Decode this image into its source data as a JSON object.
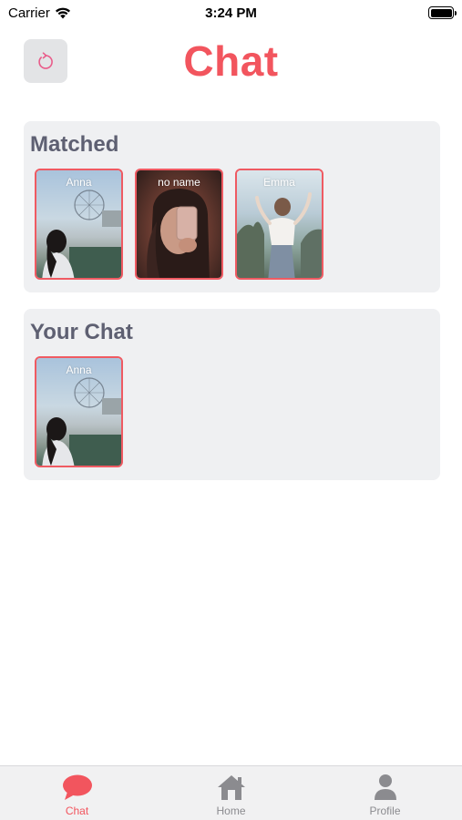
{
  "status_bar": {
    "carrier": "Carrier",
    "time": "3:24 PM"
  },
  "header": {
    "title": "Chat"
  },
  "matched": {
    "title": "Matched",
    "cards": [
      {
        "name": "Anna"
      },
      {
        "name": "no name"
      },
      {
        "name": "Emma"
      }
    ]
  },
  "your_chat": {
    "title": "Your Chat",
    "cards": [
      {
        "name": "Anna"
      }
    ]
  },
  "tab_bar": {
    "tabs": [
      {
        "label": "Chat",
        "icon": "chat-bubble-icon",
        "active": true
      },
      {
        "label": "Home",
        "icon": "home-icon",
        "active": false
      },
      {
        "label": "Profile",
        "icon": "person-icon",
        "active": false
      }
    ]
  },
  "colors": {
    "accent": "#f2555e",
    "section_bg": "#eff0f2",
    "section_title": "#5e6072"
  }
}
